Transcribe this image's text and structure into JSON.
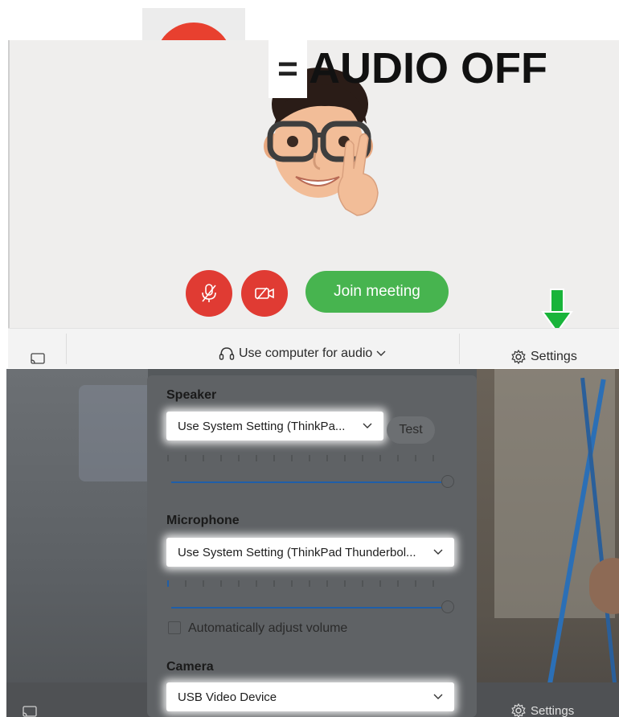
{
  "overlay": {
    "equals_sign": "=",
    "caption": "AUDIO OFF"
  },
  "meeting_preview": {
    "join_button_label": "Join meeting",
    "mute_button_icon": "microphone-muted-icon",
    "video_button_icon": "camera-off-icon",
    "audio_option_label": "Use computer for audio",
    "settings_label": "Settings",
    "colors": {
      "mute_red": "#e03b33",
      "join_green": "#47b44f",
      "arrow_green": "#19b43a"
    }
  },
  "settings_panel": {
    "speaker": {
      "title": "Speaker",
      "selected": "Use System Setting (ThinkPa...",
      "test_label": "Test",
      "volume_fraction": 1.0
    },
    "microphone": {
      "title": "Microphone",
      "selected": "Use System Setting (ThinkPad Thunderbol...",
      "volume_fraction": 1.0,
      "auto_adjust_label": "Automatically adjust volume",
      "auto_adjust_checked": false
    },
    "camera": {
      "title": "Camera",
      "selected": "USB Video Device"
    },
    "settings_label": "Settings"
  }
}
